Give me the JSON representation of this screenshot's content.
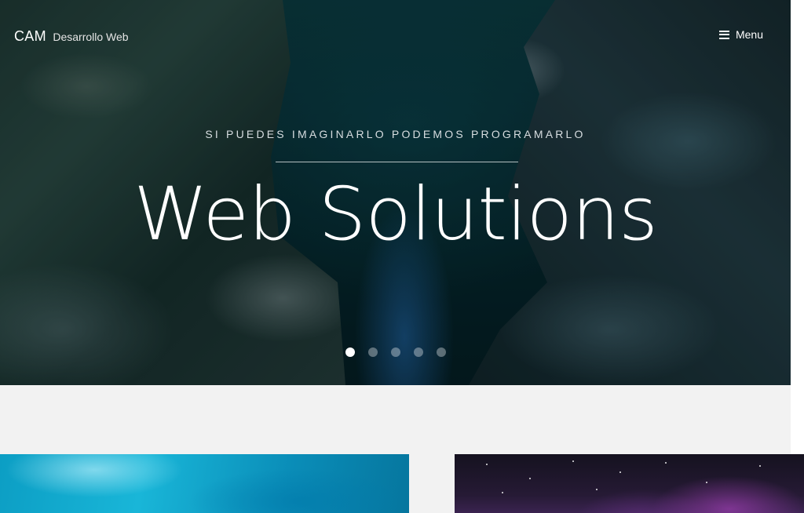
{
  "brand": {
    "name": "CAM",
    "tagline": "Desarrollo Web"
  },
  "nav": {
    "menu_label": "Menu",
    "menu_icon": "bars-icon"
  },
  "hero": {
    "subtitle": "SI PUEDES IMAGINARLO PODEMOS PROGRAMARLO",
    "title": "Web Solutions",
    "slides_total": 5,
    "active_slide": 1
  },
  "colors": {
    "hero_text": "#ffffff",
    "section_bg": "#f2f2f2",
    "card_left": "#19b6d8",
    "card_right": "#261a35"
  }
}
